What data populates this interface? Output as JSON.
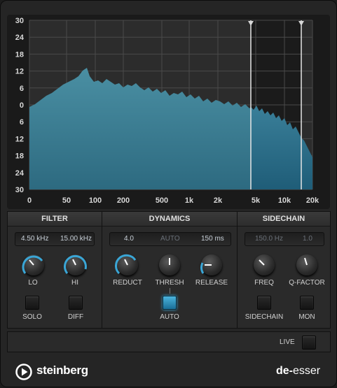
{
  "spectrum": {
    "y_ticks": [
      "30",
      "24",
      "18",
      "12",
      "6",
      "0",
      "6",
      "12",
      "18",
      "24",
      "30"
    ],
    "x_ticks": [
      "0",
      "50",
      "100",
      "200",
      "500",
      "1k",
      "2k",
      "5k",
      "10k",
      "20k"
    ]
  },
  "filter": {
    "title": "FILTER",
    "lo_value": "4.50 kHz",
    "hi_value": "15.00 kHz",
    "lo_label": "LO",
    "hi_label": "HI",
    "solo_label": "SOLO",
    "diff_label": "DIFF"
  },
  "dynamics": {
    "title": "DYNAMICS",
    "reduct_value": "4.0",
    "thresh_value": "AUTO",
    "release_value": "150 ms",
    "reduct_label": "REDUCT",
    "thresh_label": "THRESH",
    "release_label": "RELEASE",
    "auto_label": "AUTO"
  },
  "sidechain": {
    "title": "SIDECHAIN",
    "freq_value": "150.0 Hz",
    "q_value": "1.0",
    "freq_label": "FREQ",
    "q_label": "Q-FACTOR",
    "sidechain_label": "SIDECHAIN",
    "mon_label": "MON"
  },
  "live_label": "LIVE",
  "brand": "steinberg",
  "product": {
    "prefix": "de-",
    "suffix": "esser"
  },
  "colors": {
    "accent": "#3aa6d6",
    "spectrum": "#3f8296"
  }
}
